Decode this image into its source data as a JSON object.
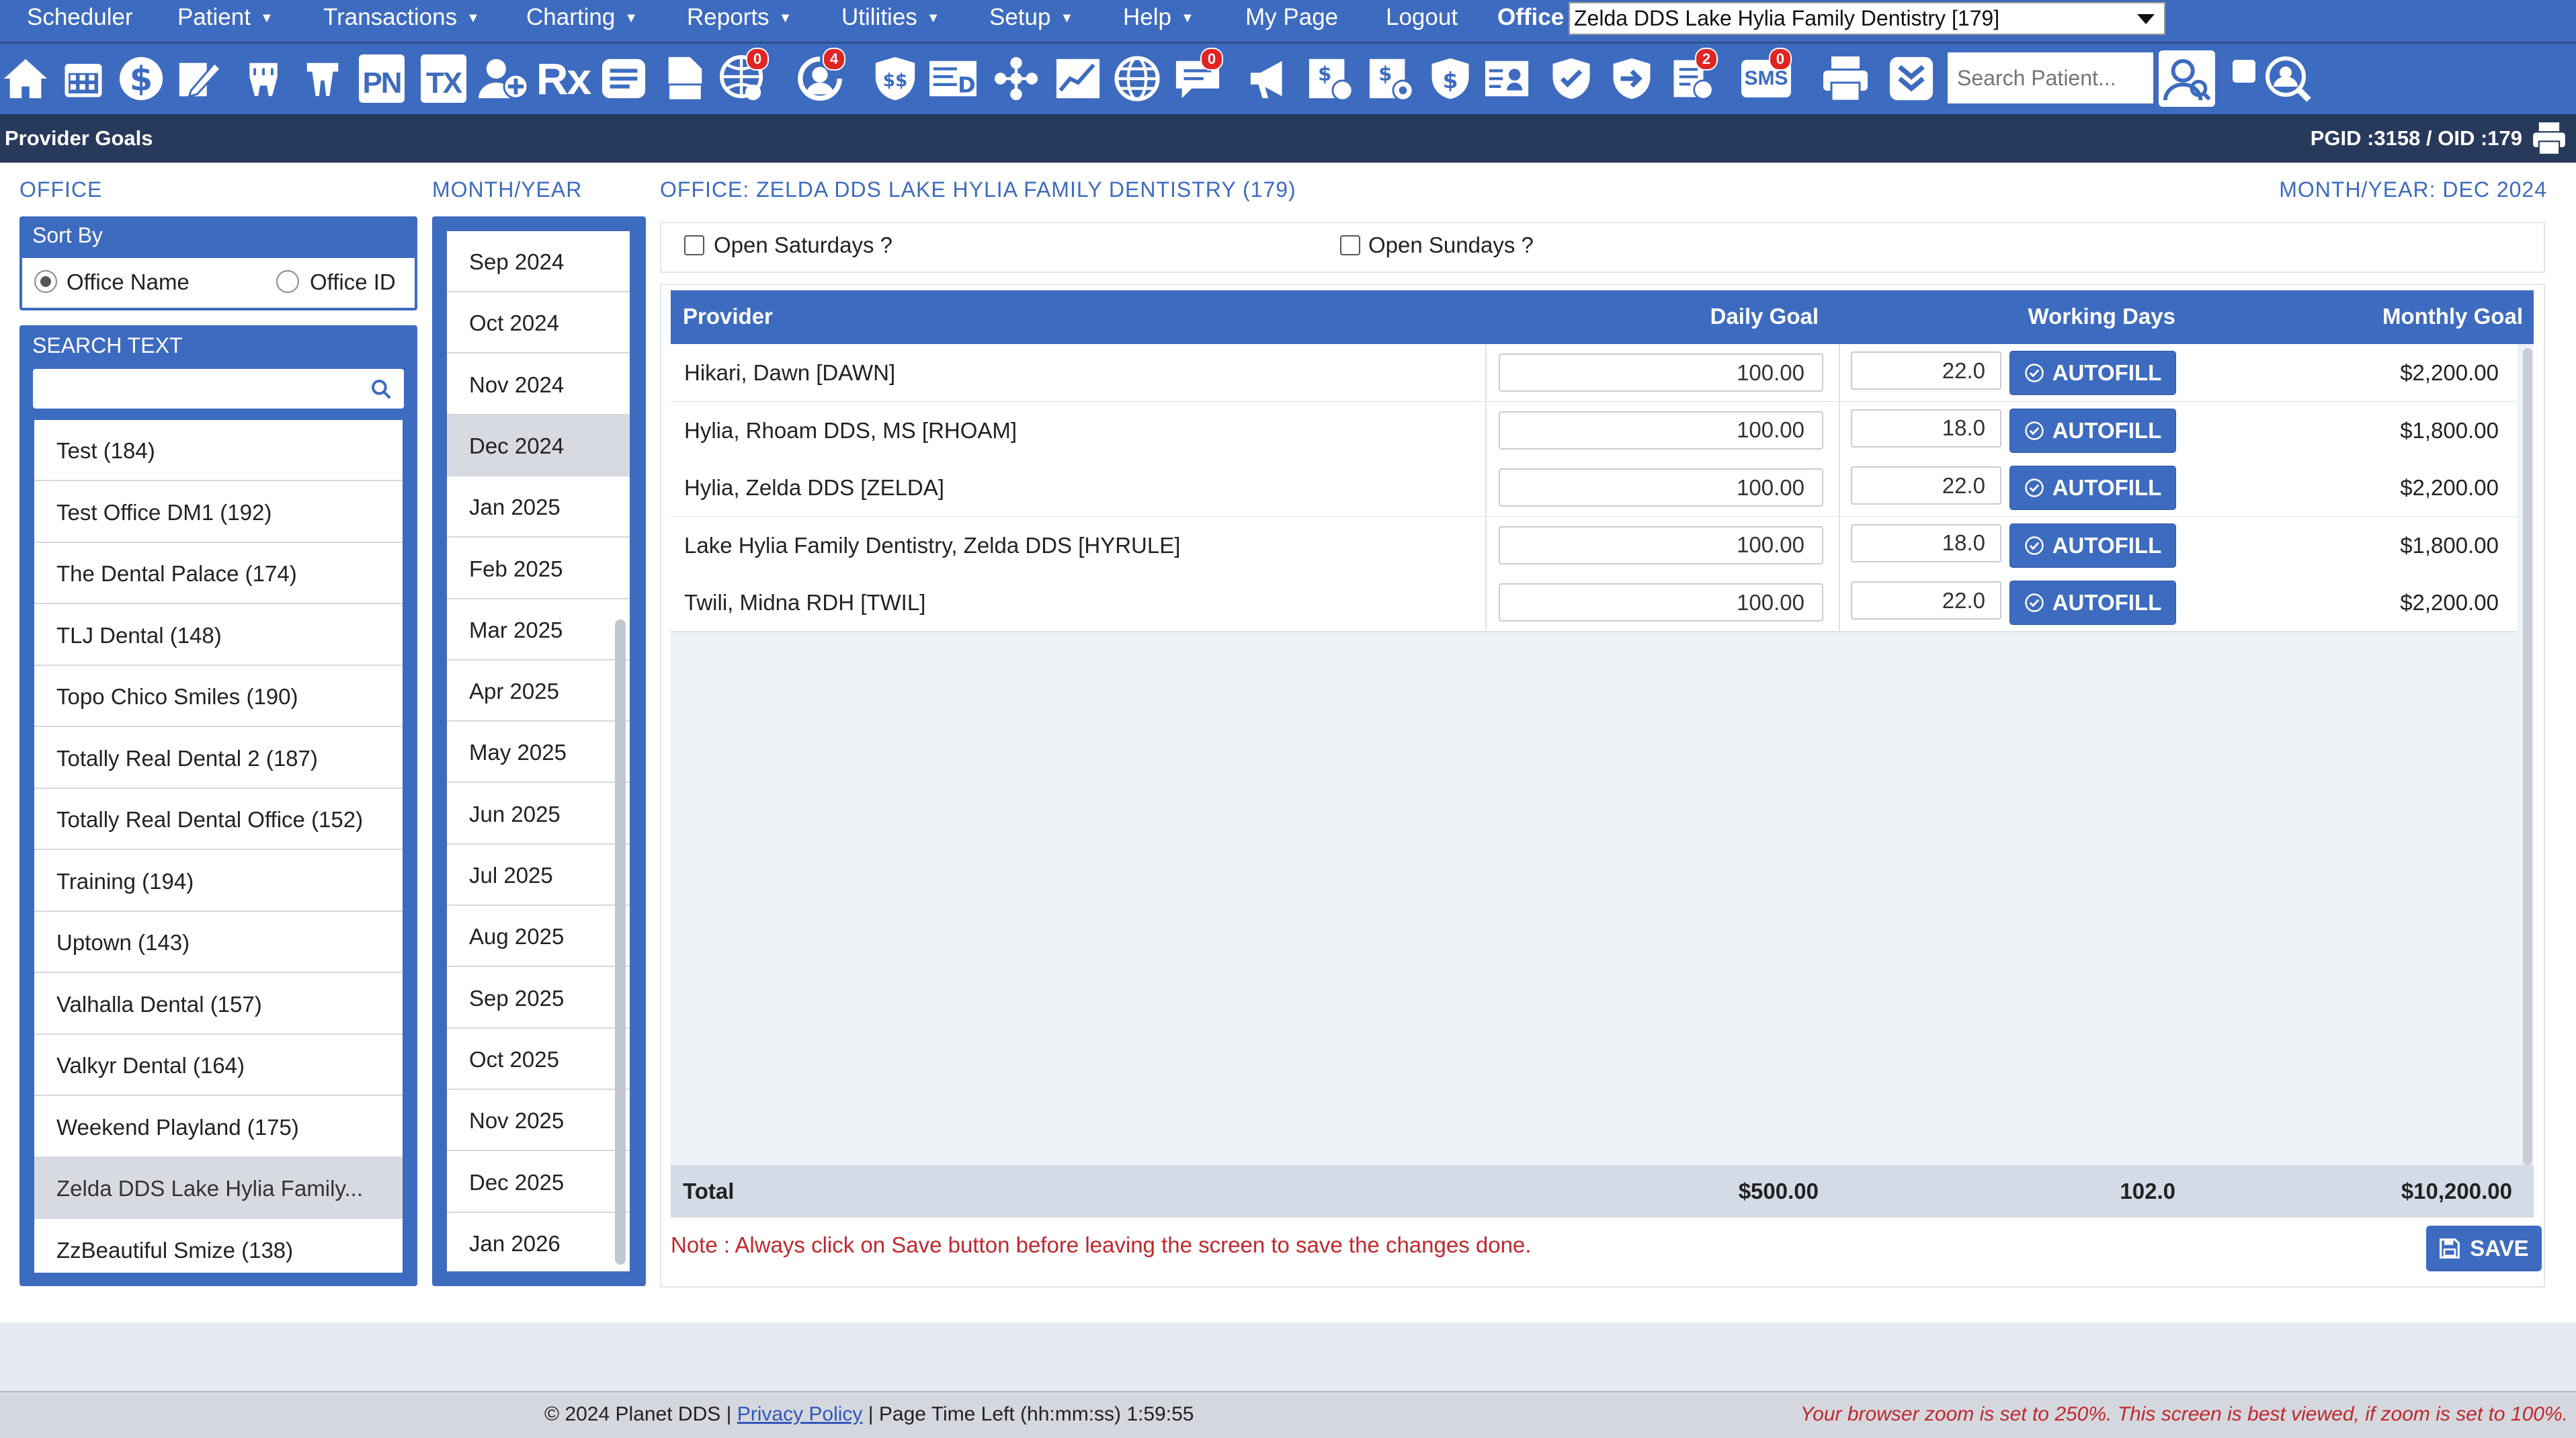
{
  "menu": {
    "items": [
      "Scheduler",
      "Patient",
      "Transactions",
      "Charting",
      "Reports",
      "Utilities",
      "Setup",
      "Help",
      "My Page",
      "Logout"
    ],
    "office_label": "Office",
    "office_value": "Zelda DDS Lake Hylia Family Dentistry [179]"
  },
  "toolbar": {
    "icon_texts": {
      "pn": "PN",
      "tx": "TX",
      "rx": "Rx",
      "sms": "SMS"
    },
    "badges": {
      "globe": "0",
      "refresh": "4",
      "chat": "0",
      "task": "2",
      "sms": "0"
    },
    "search_placeholder": "Search Patient..."
  },
  "titlebar": {
    "title": "Provider Goals",
    "ids": "PGID :3158  /  OID :179"
  },
  "office_panel": {
    "heading": "OFFICE",
    "sort_by_label": "Sort By",
    "sort_options": [
      "Office Name",
      "Office ID"
    ],
    "sort_selected": "Office Name",
    "search_label": "SEARCH TEXT",
    "search_value": "",
    "offices": [
      "Test (184)",
      "Test Office DM1 (192)",
      "The Dental Palace (174)",
      "TLJ Dental (148)",
      "Topo Chico Smiles (190)",
      "Totally Real Dental 2 (187)",
      "Totally Real Dental Office (152)",
      "Training (194)",
      "Uptown (143)",
      "Valhalla Dental (157)",
      "Valkyr Dental (164)",
      "Weekend Playland (175)",
      "Zelda DDS Lake Hylia Family...",
      "ZzBeautiful Smize (138)"
    ],
    "selected_office": "Zelda DDS Lake Hylia Family..."
  },
  "month_panel": {
    "heading": "MONTH/YEAR",
    "months": [
      "Sep 2024",
      "Oct 2024",
      "Nov 2024",
      "Dec 2024",
      "Jan 2025",
      "Feb 2025",
      "Mar 2025",
      "Apr 2025",
      "May 2025",
      "Jun 2025",
      "Jul 2025",
      "Aug 2025",
      "Sep 2025",
      "Oct 2025",
      "Nov 2025",
      "Dec 2025",
      "Jan 2026"
    ],
    "selected_month": "Dec 2024"
  },
  "main": {
    "office_heading": "OFFICE: ZELDA DDS LAKE HYLIA FAMILY DENTISTRY (179)",
    "month_heading": "MONTH/YEAR: DEC 2024",
    "open_saturdays": "Open Saturdays ?",
    "open_sundays": "Open Sundays ?",
    "columns": {
      "provider": "Provider",
      "daily_goal": "Daily Goal",
      "working_days": "Working Days",
      "monthly_goal": "Monthly Goal"
    },
    "autofill_label": "AUTOFILL",
    "rows": [
      {
        "provider": "Hikari, Dawn [DAWN]",
        "daily_goal": "100.00",
        "working_days": "22.0",
        "monthly_goal": "$2,200.00"
      },
      {
        "provider": "Hylia, Rhoam DDS, MS [RHOAM]",
        "daily_goal": "100.00",
        "working_days": "18.0",
        "monthly_goal": "$1,800.00"
      },
      {
        "provider": "Hylia, Zelda DDS [ZELDA]",
        "daily_goal": "100.00",
        "working_days": "22.0",
        "monthly_goal": "$2,200.00"
      },
      {
        "provider": "Lake Hylia Family Dentistry, Zelda DDS [HYRULE]",
        "daily_goal": "100.00",
        "working_days": "18.0",
        "monthly_goal": "$1,800.00"
      },
      {
        "provider": "Twili, Midna RDH [TWIL]",
        "daily_goal": "100.00",
        "working_days": "22.0",
        "monthly_goal": "$2,200.00"
      }
    ],
    "total": {
      "label": "Total",
      "daily_goal": "$500.00",
      "working_days": "102.0",
      "monthly_goal": "$10,200.00"
    },
    "note": "Note : Always click on Save button before leaving the screen to save the changes done.",
    "save_label": "SAVE"
  },
  "footer": {
    "copyright": "© 2024 Planet DDS | ",
    "privacy": "Privacy Policy",
    "time_left": " |  Page Time Left (hh:mm:ss) 1:59:55",
    "zoom_warning": "Your browser zoom is set to 250%. This screen is best viewed, if zoom is set to 100%."
  },
  "colors": {
    "primary": "#3d6bbf",
    "titlebar": "#283a5c",
    "note": "#c0282d",
    "badge": "#e02424"
  }
}
